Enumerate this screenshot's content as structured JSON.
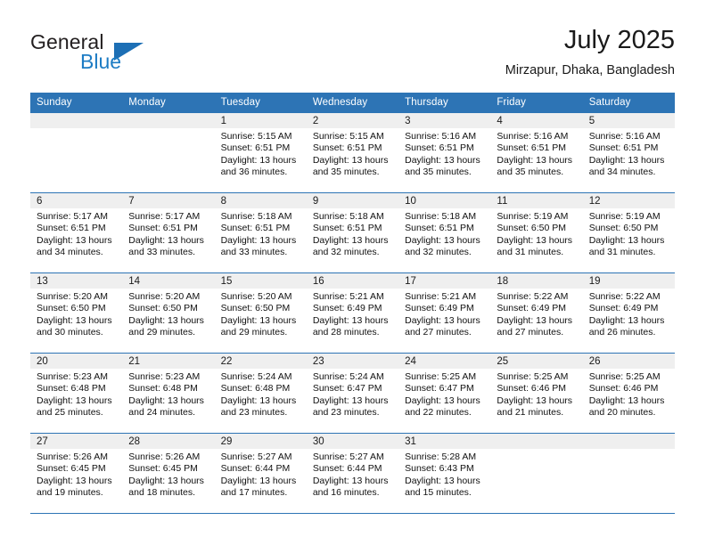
{
  "brand": {
    "name_part1": "General",
    "name_part2": "Blue",
    "logo_icon": "triangle-logo-icon"
  },
  "header": {
    "month_title": "July 2025",
    "location": "Mirzapur, Dhaka, Bangladesh"
  },
  "calendar": {
    "weekday_headers": [
      "Sunday",
      "Monday",
      "Tuesday",
      "Wednesday",
      "Thursday",
      "Friday",
      "Saturday"
    ],
    "colors": {
      "header_blue": "#2d74b5",
      "daynum_band": "#efefef",
      "brand_blue": "#1d7cc4",
      "text": "#1a1a1a"
    },
    "weeks": [
      [
        {
          "day": "",
          "sunrise": "",
          "sunset": "",
          "daylight": ""
        },
        {
          "day": "",
          "sunrise": "",
          "sunset": "",
          "daylight": ""
        },
        {
          "day": "1",
          "sunrise": "Sunrise: 5:15 AM",
          "sunset": "Sunset: 6:51 PM",
          "daylight": "Daylight: 13 hours and 36 minutes."
        },
        {
          "day": "2",
          "sunrise": "Sunrise: 5:15 AM",
          "sunset": "Sunset: 6:51 PM",
          "daylight": "Daylight: 13 hours and 35 minutes."
        },
        {
          "day": "3",
          "sunrise": "Sunrise: 5:16 AM",
          "sunset": "Sunset: 6:51 PM",
          "daylight": "Daylight: 13 hours and 35 minutes."
        },
        {
          "day": "4",
          "sunrise": "Sunrise: 5:16 AM",
          "sunset": "Sunset: 6:51 PM",
          "daylight": "Daylight: 13 hours and 35 minutes."
        },
        {
          "day": "5",
          "sunrise": "Sunrise: 5:16 AM",
          "sunset": "Sunset: 6:51 PM",
          "daylight": "Daylight: 13 hours and 34 minutes."
        }
      ],
      [
        {
          "day": "6",
          "sunrise": "Sunrise: 5:17 AM",
          "sunset": "Sunset: 6:51 PM",
          "daylight": "Daylight: 13 hours and 34 minutes."
        },
        {
          "day": "7",
          "sunrise": "Sunrise: 5:17 AM",
          "sunset": "Sunset: 6:51 PM",
          "daylight": "Daylight: 13 hours and 33 minutes."
        },
        {
          "day": "8",
          "sunrise": "Sunrise: 5:18 AM",
          "sunset": "Sunset: 6:51 PM",
          "daylight": "Daylight: 13 hours and 33 minutes."
        },
        {
          "day": "9",
          "sunrise": "Sunrise: 5:18 AM",
          "sunset": "Sunset: 6:51 PM",
          "daylight": "Daylight: 13 hours and 32 minutes."
        },
        {
          "day": "10",
          "sunrise": "Sunrise: 5:18 AM",
          "sunset": "Sunset: 6:51 PM",
          "daylight": "Daylight: 13 hours and 32 minutes."
        },
        {
          "day": "11",
          "sunrise": "Sunrise: 5:19 AM",
          "sunset": "Sunset: 6:50 PM",
          "daylight": "Daylight: 13 hours and 31 minutes."
        },
        {
          "day": "12",
          "sunrise": "Sunrise: 5:19 AM",
          "sunset": "Sunset: 6:50 PM",
          "daylight": "Daylight: 13 hours and 31 minutes."
        }
      ],
      [
        {
          "day": "13",
          "sunrise": "Sunrise: 5:20 AM",
          "sunset": "Sunset: 6:50 PM",
          "daylight": "Daylight: 13 hours and 30 minutes."
        },
        {
          "day": "14",
          "sunrise": "Sunrise: 5:20 AM",
          "sunset": "Sunset: 6:50 PM",
          "daylight": "Daylight: 13 hours and 29 minutes."
        },
        {
          "day": "15",
          "sunrise": "Sunrise: 5:20 AM",
          "sunset": "Sunset: 6:50 PM",
          "daylight": "Daylight: 13 hours and 29 minutes."
        },
        {
          "day": "16",
          "sunrise": "Sunrise: 5:21 AM",
          "sunset": "Sunset: 6:49 PM",
          "daylight": "Daylight: 13 hours and 28 minutes."
        },
        {
          "day": "17",
          "sunrise": "Sunrise: 5:21 AM",
          "sunset": "Sunset: 6:49 PM",
          "daylight": "Daylight: 13 hours and 27 minutes."
        },
        {
          "day": "18",
          "sunrise": "Sunrise: 5:22 AM",
          "sunset": "Sunset: 6:49 PM",
          "daylight": "Daylight: 13 hours and 27 minutes."
        },
        {
          "day": "19",
          "sunrise": "Sunrise: 5:22 AM",
          "sunset": "Sunset: 6:49 PM",
          "daylight": "Daylight: 13 hours and 26 minutes."
        }
      ],
      [
        {
          "day": "20",
          "sunrise": "Sunrise: 5:23 AM",
          "sunset": "Sunset: 6:48 PM",
          "daylight": "Daylight: 13 hours and 25 minutes."
        },
        {
          "day": "21",
          "sunrise": "Sunrise: 5:23 AM",
          "sunset": "Sunset: 6:48 PM",
          "daylight": "Daylight: 13 hours and 24 minutes."
        },
        {
          "day": "22",
          "sunrise": "Sunrise: 5:24 AM",
          "sunset": "Sunset: 6:48 PM",
          "daylight": "Daylight: 13 hours and 23 minutes."
        },
        {
          "day": "23",
          "sunrise": "Sunrise: 5:24 AM",
          "sunset": "Sunset: 6:47 PM",
          "daylight": "Daylight: 13 hours and 23 minutes."
        },
        {
          "day": "24",
          "sunrise": "Sunrise: 5:25 AM",
          "sunset": "Sunset: 6:47 PM",
          "daylight": "Daylight: 13 hours and 22 minutes."
        },
        {
          "day": "25",
          "sunrise": "Sunrise: 5:25 AM",
          "sunset": "Sunset: 6:46 PM",
          "daylight": "Daylight: 13 hours and 21 minutes."
        },
        {
          "day": "26",
          "sunrise": "Sunrise: 5:25 AM",
          "sunset": "Sunset: 6:46 PM",
          "daylight": "Daylight: 13 hours and 20 minutes."
        }
      ],
      [
        {
          "day": "27",
          "sunrise": "Sunrise: 5:26 AM",
          "sunset": "Sunset: 6:45 PM",
          "daylight": "Daylight: 13 hours and 19 minutes."
        },
        {
          "day": "28",
          "sunrise": "Sunrise: 5:26 AM",
          "sunset": "Sunset: 6:45 PM",
          "daylight": "Daylight: 13 hours and 18 minutes."
        },
        {
          "day": "29",
          "sunrise": "Sunrise: 5:27 AM",
          "sunset": "Sunset: 6:44 PM",
          "daylight": "Daylight: 13 hours and 17 minutes."
        },
        {
          "day": "30",
          "sunrise": "Sunrise: 5:27 AM",
          "sunset": "Sunset: 6:44 PM",
          "daylight": "Daylight: 13 hours and 16 minutes."
        },
        {
          "day": "31",
          "sunrise": "Sunrise: 5:28 AM",
          "sunset": "Sunset: 6:43 PM",
          "daylight": "Daylight: 13 hours and 15 minutes."
        },
        {
          "day": "",
          "sunrise": "",
          "sunset": "",
          "daylight": ""
        },
        {
          "day": "",
          "sunrise": "",
          "sunset": "",
          "daylight": ""
        }
      ]
    ]
  }
}
